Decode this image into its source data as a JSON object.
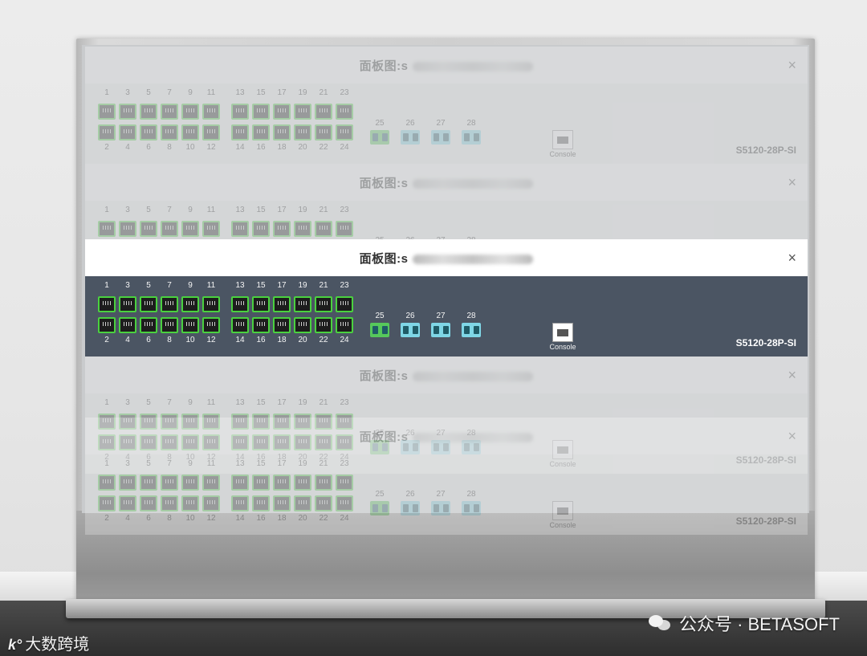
{
  "panel": {
    "title": "面板图:s",
    "close": "×",
    "top_port_numbers": [
      "1",
      "3",
      "5",
      "7",
      "9",
      "11",
      "13",
      "15",
      "17",
      "19",
      "21",
      "23"
    ],
    "bottom_port_numbers": [
      "2",
      "4",
      "6",
      "8",
      "10",
      "12",
      "14",
      "16",
      "18",
      "20",
      "22",
      "24"
    ],
    "sfp_ports": [
      "25",
      "26",
      "27",
      "28"
    ],
    "console_label": "Console",
    "model": "S5120-28P-SI"
  },
  "watermark": {
    "left": "大数跨境",
    "right": "公众号 · BETASOFT"
  }
}
